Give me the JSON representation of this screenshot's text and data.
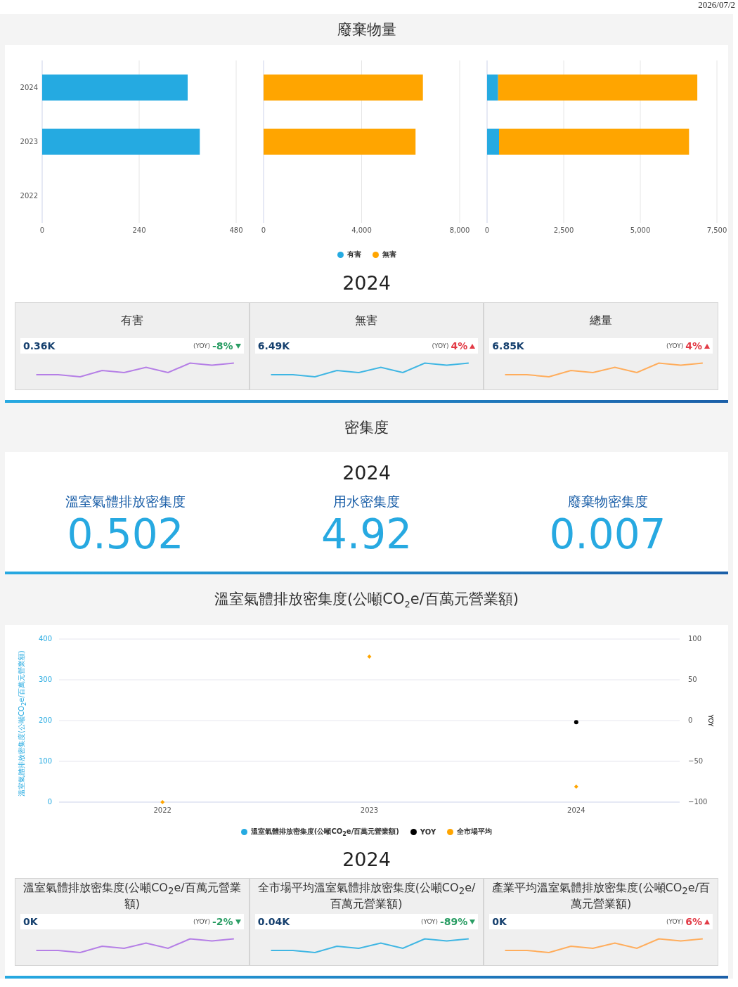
{
  "date": "2026/07/2",
  "waste": {
    "title": "廢棄物量",
    "charts": [
      {
        "chart_data": {
          "type": "bar",
          "orientation": "horizontal",
          "categories": [
            "2024",
            "2023",
            "2022"
          ],
          "xlim": [
            0,
            480
          ],
          "xticks": [
            0,
            240,
            480
          ],
          "series": [
            {
              "color": "#25aae1",
              "values": [
                360,
                390,
                null
              ]
            }
          ]
        }
      },
      {
        "chart_data": {
          "type": "bar",
          "orientation": "horizontal",
          "xlim": [
            0,
            8000
          ],
          "xticks": [
            {
              "value": 0,
              "label": "0"
            },
            {
              "value": 4000,
              "label": "4,000"
            },
            {
              "value": 8000,
              "label": "8,000"
            }
          ],
          "series": [
            {
              "color": "#ffa500",
              "values": [
                6500,
                6200,
                null
              ]
            }
          ]
        }
      },
      {
        "chart_data": {
          "type": "bar",
          "orientation": "horizontal",
          "stacked": true,
          "xlim": [
            0,
            7500
          ],
          "xticks": [
            {
              "value": 0,
              "label": "0"
            },
            {
              "value": 2500,
              "label": "2,500"
            },
            {
              "value": 5000,
              "label": "5,000"
            },
            {
              "value": 7500,
              "label": "7,500"
            }
          ],
          "series": [
            {
              "name": "有害",
              "color": "#25aae1",
              "values": [
                360,
                390,
                null
              ]
            },
            {
              "name": "無害",
              "color": "#ffa500",
              "values": [
                6500,
                6200,
                null
              ]
            }
          ]
        }
      }
    ],
    "year": "2024",
    "kpis": [
      {
        "title": "有害",
        "value": "0.36K",
        "yoy_label": "(YOY)",
        "yoy": "-8%",
        "increase": false,
        "color": "#b57fe6"
      },
      {
        "title": "無害",
        "value": "6.49K",
        "yoy_label": "(YOY)",
        "yoy": "4%",
        "increase": true,
        "color": "#3fb6e3"
      },
      {
        "title": "總量",
        "value": "6.85K",
        "yoy_label": "(YOY)",
        "yoy": "4%",
        "increase": true,
        "color": "#ffad5c"
      }
    ]
  },
  "density": {
    "title": "密集度",
    "year": "2024",
    "metrics": [
      {
        "label": "溫室氣體排放密集度",
        "value": "0.502"
      },
      {
        "label": "用水密集度",
        "value": "4.92"
      },
      {
        "label": "廢棄物密集度",
        "value": "0.007"
      }
    ]
  },
  "ghg": {
    "title": "溫室氣體排放密集度(公噸CO$_{2}$e/百萬元營業額)",
    "chart_data": {
      "type": "scatter",
      "grid": true,
      "categories": [
        "2022",
        "2023",
        "2024"
      ],
      "ylabel": "溫室氣體排放密集度(公噸CO$_{2}$e/百萬元營業額)",
      "ylim": [
        0,
        400
      ],
      "yticks": [
        0,
        100,
        200,
        300,
        400
      ],
      "y2label": "YOY",
      "y2lim": [
        -100,
        100
      ],
      "y2ticks": [
        {
          "value": -100,
          "label": "−100"
        },
        {
          "value": -50,
          "label": "−50"
        },
        {
          "value": 0,
          "label": "0"
        },
        {
          "value": 50,
          "label": "50"
        },
        {
          "value": 100,
          "label": "100"
        }
      ],
      "series": [
        {
          "name": "溫室氣體排放密集度(公噸CO$_{2}$e/百萬元營業額)",
          "color": "#25aae1",
          "values": [
            null,
            null,
            null
          ]
        },
        {
          "name": "YOY",
          "color": "#000000",
          "axis": "y2",
          "values": [
            null,
            null,
            -2
          ]
        },
        {
          "name": "全市場平均",
          "color": "#ffa500",
          "values": [
            0,
            357,
            38
          ]
        }
      ]
    },
    "year": "2024",
    "kpis": [
      {
        "title": "溫室氣體排放密集度(公噸CO$_{2}$e/百萬元營業額)",
        "value": "0K",
        "yoy_label": "(YOY)",
        "yoy": "-2%",
        "increase": false,
        "color": "#b57fe6"
      },
      {
        "title": "全市場平均溫室氣體排放密集度(公噸CO$_{2}$e/百萬元營業額)",
        "value": "0.04K",
        "yoy_label": "(YOY)",
        "yoy": "-89%",
        "increase": false,
        "color": "#3fb6e3"
      },
      {
        "title": "產業平均溫室氣體排放密集度(公噸CO$_{2}$e/百萬元營業額)",
        "value": "0K",
        "yoy_label": "(YOY)",
        "yoy": "6%",
        "increase": true,
        "color": "#ffad5c"
      }
    ]
  }
}
